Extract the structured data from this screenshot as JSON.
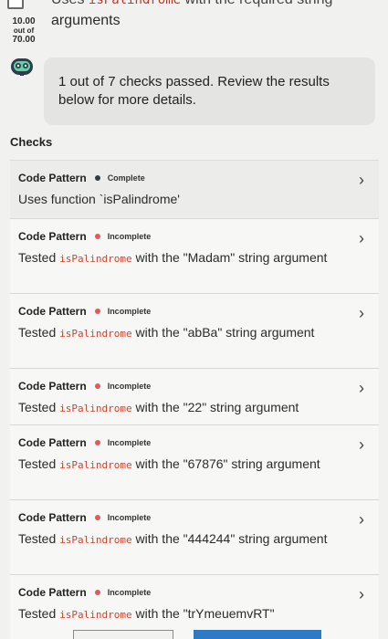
{
  "header": {
    "cut_text_prefix": "Uses",
    "cut_text_code": "isPalindrome",
    "cut_text_suffix": "with the required string",
    "score_value": "10.00",
    "score_out_of": "out of",
    "score_max": "70.00",
    "title": "arguments"
  },
  "result": {
    "message": "1 out of 7 checks passed. Review the results below for more details."
  },
  "checks_heading": "Checks",
  "checks": [
    {
      "type": "Code Pattern",
      "status": "Complete",
      "status_key": "complete",
      "desc_prefix": "Uses function `isPalindrome'",
      "code": "",
      "desc_suffix": ""
    },
    {
      "type": "Code Pattern",
      "status": "Incomplete",
      "status_key": "incomplete",
      "desc_prefix": "Tested",
      "code": "isPalindrome",
      "desc_suffix": "with the \"Madam\" string argument"
    },
    {
      "type": "Code Pattern",
      "status": "Incomplete",
      "status_key": "incomplete",
      "desc_prefix": "Tested",
      "code": "isPalindrome",
      "desc_suffix": "with the \"abBa\" string argument"
    },
    {
      "type": "Code Pattern",
      "status": "Incomplete",
      "status_key": "incomplete",
      "desc_prefix": "Tested",
      "code": "isPalindrome",
      "desc_suffix": "with the \"22\" string argument"
    },
    {
      "type": "Code Pattern",
      "status": "Incomplete",
      "status_key": "incomplete",
      "desc_prefix": "Tested",
      "code": "isPalindrome",
      "desc_suffix": "with the \"67876\" string argument"
    },
    {
      "type": "Code Pattern",
      "status": "Incomplete",
      "status_key": "incomplete",
      "desc_prefix": "Tested",
      "code": "isPalindrome",
      "desc_suffix": "with the \"444244\" string argument"
    },
    {
      "type": "Code Pattern",
      "status": "Incomplete",
      "status_key": "incomplete",
      "desc_prefix": "Tested",
      "code": "isPalindrome",
      "desc_suffix": "with the \"trYmeuemvRT\""
    }
  ],
  "icons": {
    "robot": "robot-icon",
    "chevron": "chevron-right-icon",
    "checkbox": "checkbox-icon"
  },
  "colors": {
    "complete": "#2f3d4a",
    "incomplete": "#e05a5a",
    "code": "#d2452f",
    "accent_button": "#2d7bc7"
  }
}
